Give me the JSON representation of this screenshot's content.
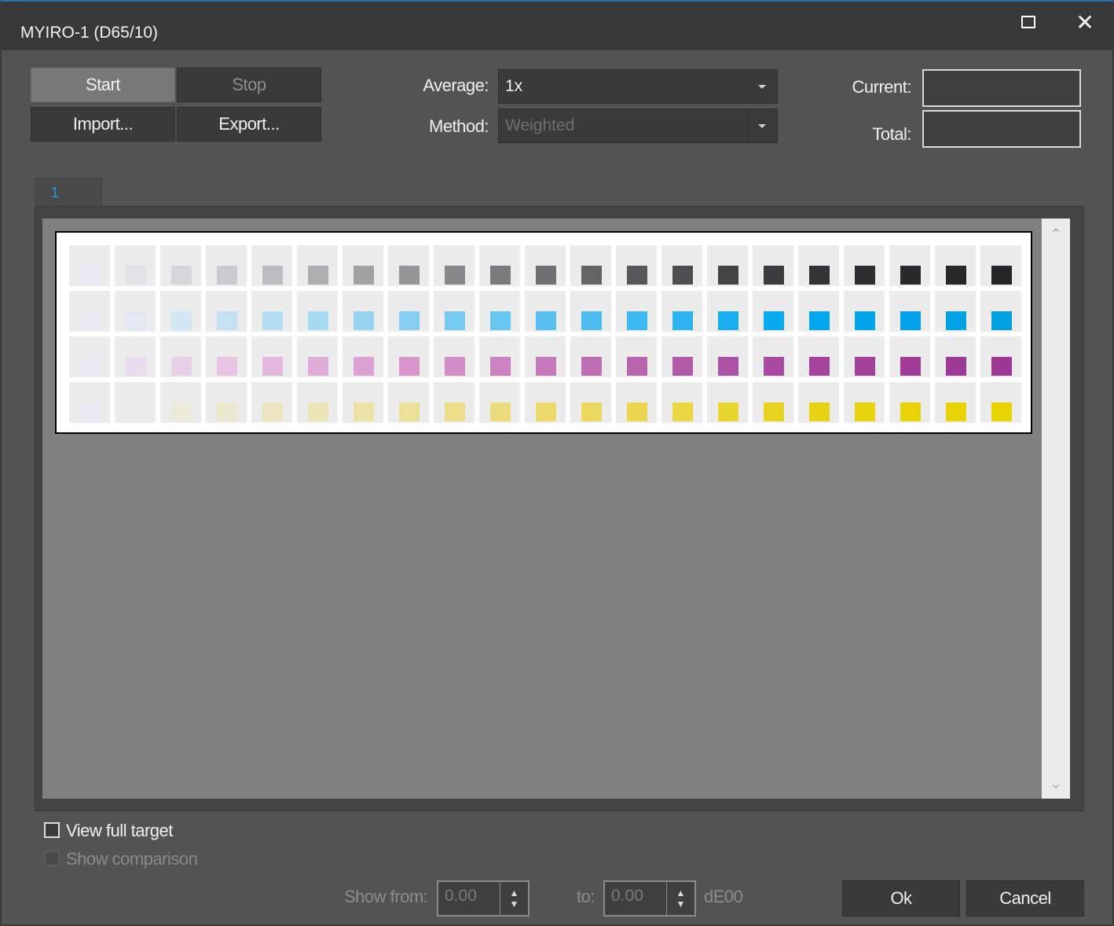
{
  "window": {
    "title": "MYIRO-1 (D65/10)",
    "close_glyph": "✕"
  },
  "toolbar": {
    "start_label": "Start",
    "stop_label": "Stop",
    "import_label": "Import...",
    "export_label": "Export..."
  },
  "settings": {
    "average_label": "Average:",
    "average_value": "1x",
    "method_label": "Method:",
    "method_value": "Weighted",
    "current_label": "Current:",
    "current_value": "",
    "total_label": "Total:",
    "total_value": ""
  },
  "tabs": [
    {
      "label": "1"
    }
  ],
  "target": {
    "columns": 21,
    "rows": [
      {
        "name": "gray",
        "colors": [
          "#eaeaf4",
          "#e2e2e8",
          "#d6d6dc",
          "#cacacf",
          "#bcbcc0",
          "#afafb2",
          "#a2a2a5",
          "#959597",
          "#88888a",
          "#7c7c7e",
          "#707072",
          "#646466",
          "#58585a",
          "#4e4e50",
          "#444446",
          "#3b3b3d",
          "#333335",
          "#2d2d2f",
          "#29292b",
          "#272729",
          "#252527"
        ]
      },
      {
        "name": "cyan",
        "colors": [
          "#eaeaf4",
          "#e2e8f2",
          "#d2e6f4",
          "#c4e2f2",
          "#b4ddf2",
          "#a6d9f2",
          "#96d4f2",
          "#86cff2",
          "#76caf2",
          "#68c6f2",
          "#58c1f2",
          "#4ebdf2",
          "#3cb8f2",
          "#2cb3f0",
          "#18aeef",
          "#0aaaf0",
          "#04a7ee",
          "#02a5ec",
          "#02a3ea",
          "#02a2e6",
          "#02a0e0"
        ]
      },
      {
        "name": "magenta",
        "colors": [
          "#eaeaf4",
          "#eadcee",
          "#e8d0e6",
          "#e6c4e2",
          "#e4b8de",
          "#e0acd8",
          "#dca2d2",
          "#d896cc",
          "#d48cc6",
          "#cc82c0",
          "#c678ba",
          "#c06eb4",
          "#b864ae",
          "#b25aa8",
          "#ac52a4",
          "#a84aa0",
          "#a4449c",
          "#a2409a",
          "#a03c98",
          "#9e3a96",
          "#9c3894"
        ]
      },
      {
        "name": "yellow",
        "colors": [
          "#eaeaf4",
          "#ececec",
          "#ecebda",
          "#ece8cc",
          "#ece6c0",
          "#ece4b4",
          "#ece2a6",
          "#ece098",
          "#ecdd8a",
          "#ecdb7c",
          "#ecd96c",
          "#ebd85e",
          "#ebd64e",
          "#ead63e",
          "#e9d530",
          "#e8d420",
          "#e8d414",
          "#e8d40c",
          "#e8d408",
          "#e8d404",
          "#e8d400"
        ]
      }
    ]
  },
  "options": {
    "view_full_target_label": "View full target",
    "view_full_target_checked": false,
    "show_comparison_label": "Show comparison",
    "show_comparison_checked": false
  },
  "range": {
    "show_from_label": "Show from:",
    "from_value": "0.00",
    "to_label": "to:",
    "to_value": "0.00",
    "unit_label": "dE00"
  },
  "footer": {
    "ok_label": "Ok",
    "cancel_label": "Cancel"
  }
}
